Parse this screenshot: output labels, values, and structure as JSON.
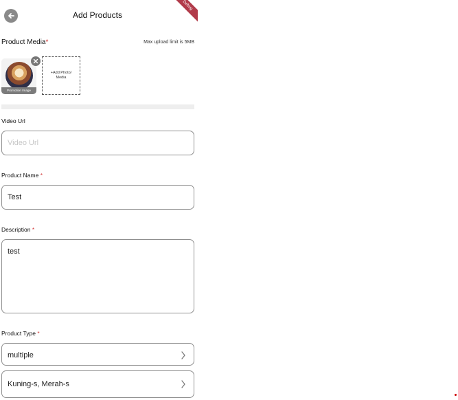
{
  "header": {
    "title": "Add Products",
    "debug_banner": "Debug",
    "back_icon": "arrow-left-icon"
  },
  "media": {
    "label": "Product Media",
    "required_mark": "*",
    "upload_limit": "Max upload limit is 5MB",
    "thumbnail_caption": "Promotion Image",
    "add_label": "+Add Photo/ Media",
    "remove_icon": "close-icon"
  },
  "video": {
    "label": "Video Url",
    "placeholder": "Video Url"
  },
  "product_name": {
    "label": "Product Name",
    "required_mark": "*",
    "value": "Test"
  },
  "description": {
    "label": "Description",
    "required_mark": "*",
    "value": "test"
  },
  "product_type": {
    "label": "Product Type",
    "required_mark": "*",
    "value": "multiple"
  },
  "variants": {
    "value": "Kuning-s, Merah-s"
  },
  "colors": {
    "accent_red": "#d33a3a",
    "debug_banner": "#b13b4a",
    "border": "#8f8f8f"
  }
}
